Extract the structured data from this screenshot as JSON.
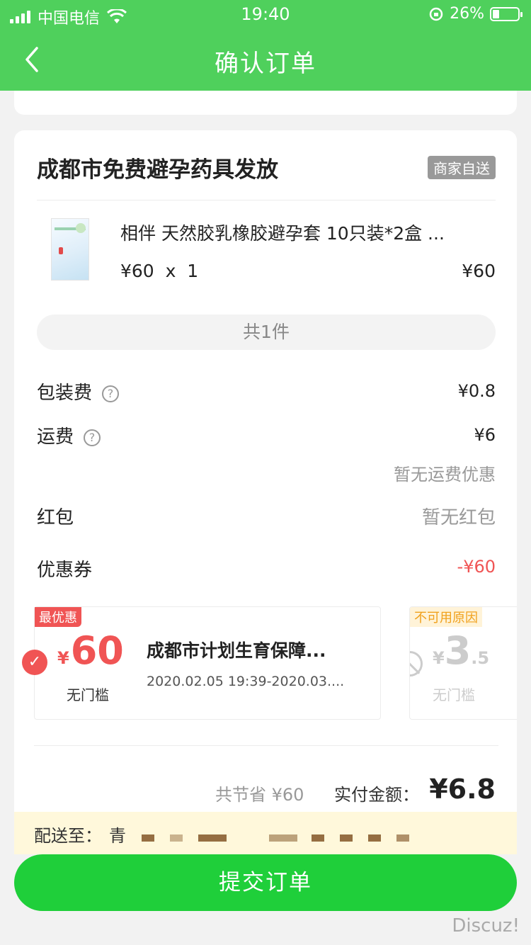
{
  "status_bar": {
    "carrier": "中国电信",
    "time": "19:40",
    "battery": "26%",
    "battery_level": 0.26
  },
  "nav": {
    "title": "确认订单"
  },
  "order": {
    "shop_name": "成都市免费避孕药具发放",
    "delivery_tag": "商家自送",
    "product": {
      "name": "相伴 天然胶乳橡胶避孕套 10只装*2盒 ...",
      "unit_price_qty": "¥60  x  1",
      "total": "¥60"
    },
    "item_count": "共1件"
  },
  "fees": {
    "packaging_label": "包装费",
    "packaging_value": "¥0.8",
    "shipping_label": "运费",
    "shipping_value": "¥6",
    "shipping_note": "暂无运费优惠",
    "red_packet_label": "红包",
    "red_packet_value": "暂无红包",
    "coupon_label": "优惠券",
    "coupon_value": "-¥60"
  },
  "coupons": [
    {
      "badge": "最优惠",
      "currency": "¥",
      "amount": "60",
      "threshold": "无门槛",
      "name": "成都市计划生育保障...",
      "period": "2020.02.05 19:39-2020.03...."
    },
    {
      "badge": "不可用原因",
      "currency": "¥",
      "amount": "3",
      "amount_decimal": ".5",
      "threshold": "无门槛"
    }
  ],
  "summary": {
    "saved": "共节省 ¥60",
    "pay_label": "实付金额：",
    "pay_value": "¥6.8"
  },
  "address": {
    "label": "配送至：",
    "value": "青"
  },
  "submit_label": "提交订单",
  "watermark": "Discuz!"
}
